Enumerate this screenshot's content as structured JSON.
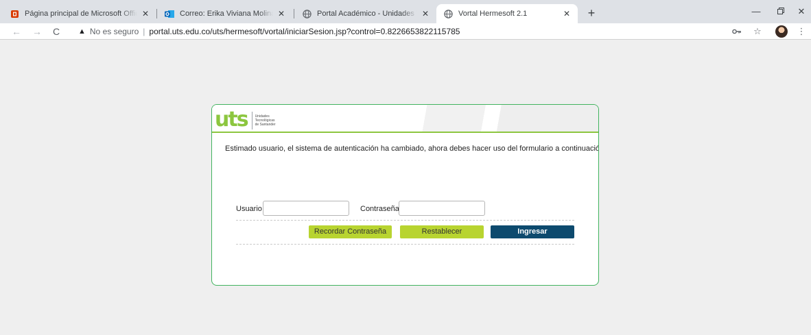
{
  "browser": {
    "tabs": [
      {
        "title": "Página principal de Microsoft Office",
        "icon": "office-icon"
      },
      {
        "title": "Correo: Erika Viviana Molina Balaguera",
        "icon": "outlook-icon"
      },
      {
        "title": "Portal Académico - Unidades Tecnológicas",
        "icon": "globe-icon"
      },
      {
        "title": "Vortal Hermesoft 2.1",
        "icon": "globe-icon",
        "active": true
      }
    ],
    "address": {
      "security_label": "No es seguro",
      "url": "portal.uts.edu.co/uts/hermesoft/vortal/iniciarSesion.jsp?control=0.8226653822115785"
    }
  },
  "page": {
    "logo_mark": "uts",
    "logo_line1": "Unidades",
    "logo_line2": "Tecnológicas",
    "logo_line3": "de Santander",
    "notice": "Estimado usuario, el sistema de autenticación ha cambiado, ahora debes hacer uso del formulario a continuación.",
    "form": {
      "user_label": "Usuario",
      "user_value": "",
      "password_label": "Contraseña",
      "password_value": ""
    },
    "buttons": {
      "recover": "Recordar Contraseña",
      "reset": "Restablecer",
      "login": "Ingresar"
    }
  },
  "colors": {
    "accent_green": "#b8d430",
    "card_border": "#41b35e",
    "login_blue": "#0d4a6e",
    "logo_green": "#8cc63f"
  }
}
